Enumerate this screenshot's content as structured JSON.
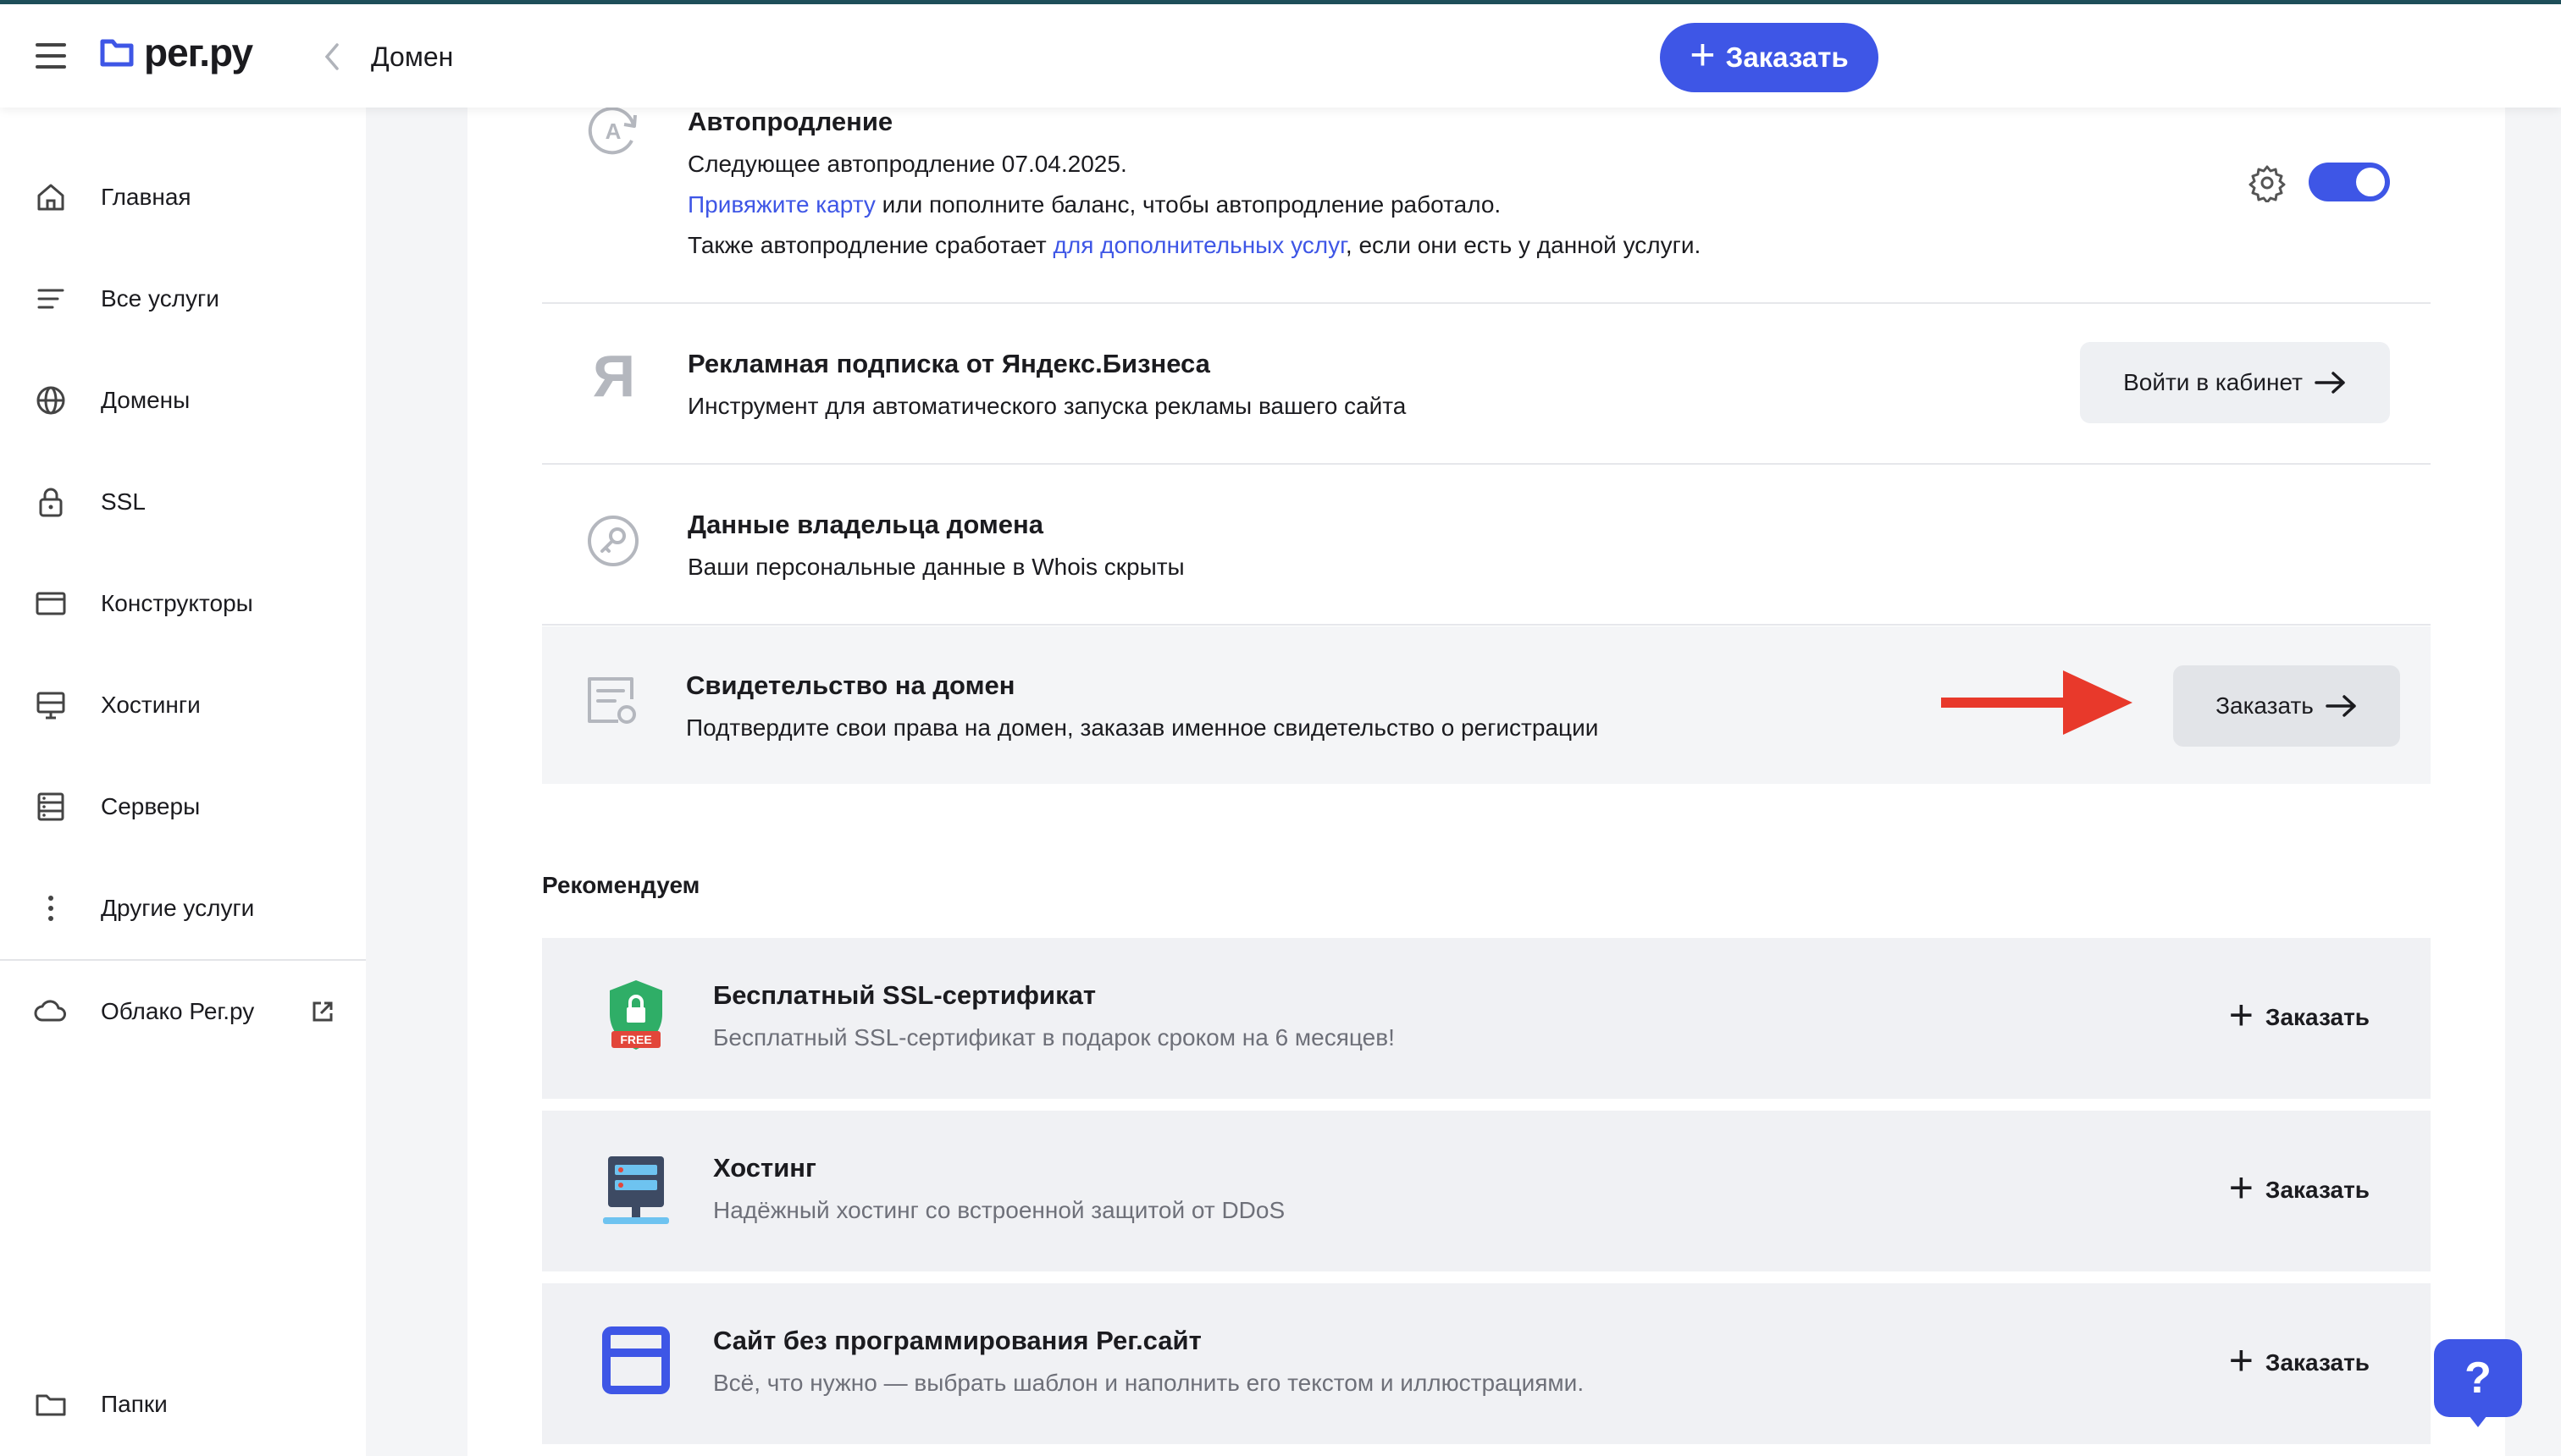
{
  "header": {
    "logo_text": "рег.ру",
    "breadcrumb": "Домен",
    "order_label": "Заказать"
  },
  "sidebar": {
    "items": [
      {
        "label": "Главная",
        "icon": "home-icon"
      },
      {
        "label": "Все услуги",
        "icon": "list-icon"
      },
      {
        "label": "Домены",
        "icon": "globe-icon"
      },
      {
        "label": "SSL",
        "icon": "lock-icon"
      },
      {
        "label": "Конструкторы",
        "icon": "window-icon"
      },
      {
        "label": "Хостинги",
        "icon": "monitor-icon"
      },
      {
        "label": "Серверы",
        "icon": "server-icon"
      },
      {
        "label": "Другие услуги",
        "icon": "more-vertical-icon"
      }
    ],
    "cloud": {
      "label": "Облако Рег.ру",
      "icon": "cloud-icon"
    },
    "folders": {
      "label": "Папки",
      "icon": "folder-icon"
    }
  },
  "services": {
    "autorenew": {
      "title": "Автопродление",
      "line1": "Следующее автопродление 07.04.2025.",
      "line2_link": "Привяжите карту",
      "line2_rest": " или пополните баланс, чтобы автопродление работало.",
      "line3_start": "Также автопродление сработает ",
      "line3_link": "для дополнительных услуг",
      "line3_end": ", если они есть у данной услуги.",
      "enabled": true
    },
    "yandex": {
      "title": "Рекламная подписка от Яндекс.Бизнеса",
      "desc": "Инструмент для автоматического запуска рекламы вашего сайта",
      "button": "Войти в кабинет"
    },
    "owner": {
      "title": "Данные владельца домена",
      "desc": "Ваши персональные данные в Whois скрыты"
    },
    "certificate": {
      "title": "Свидетельство на домен",
      "desc": "Подтвердите свои права на домен, заказав именное свидетельство о регистрации",
      "button": "Заказать"
    }
  },
  "recommend": {
    "title": "Рекомендуем",
    "items": [
      {
        "title": "Бесплатный SSL-сертификат",
        "desc": "Бесплатный SSL-сертификат в подарок сроком на 6 месяцев!",
        "action": "Заказать",
        "badge": "FREE"
      },
      {
        "title": "Хостинг",
        "desc": "Надёжный хостинг со встроенной защитой от DDoS",
        "action": "Заказать"
      },
      {
        "title": "Сайт без программирования Рег.сайт",
        "desc": "Всё, что нужно — выбрать шаблон и наполнить его текстом и иллюстрациями.",
        "action": "Заказать"
      }
    ]
  },
  "help": {
    "label": "?"
  },
  "colors": {
    "accent": "#3e56e6",
    "arrow": "#e8392b",
    "ssl_green": "#2fae67"
  }
}
